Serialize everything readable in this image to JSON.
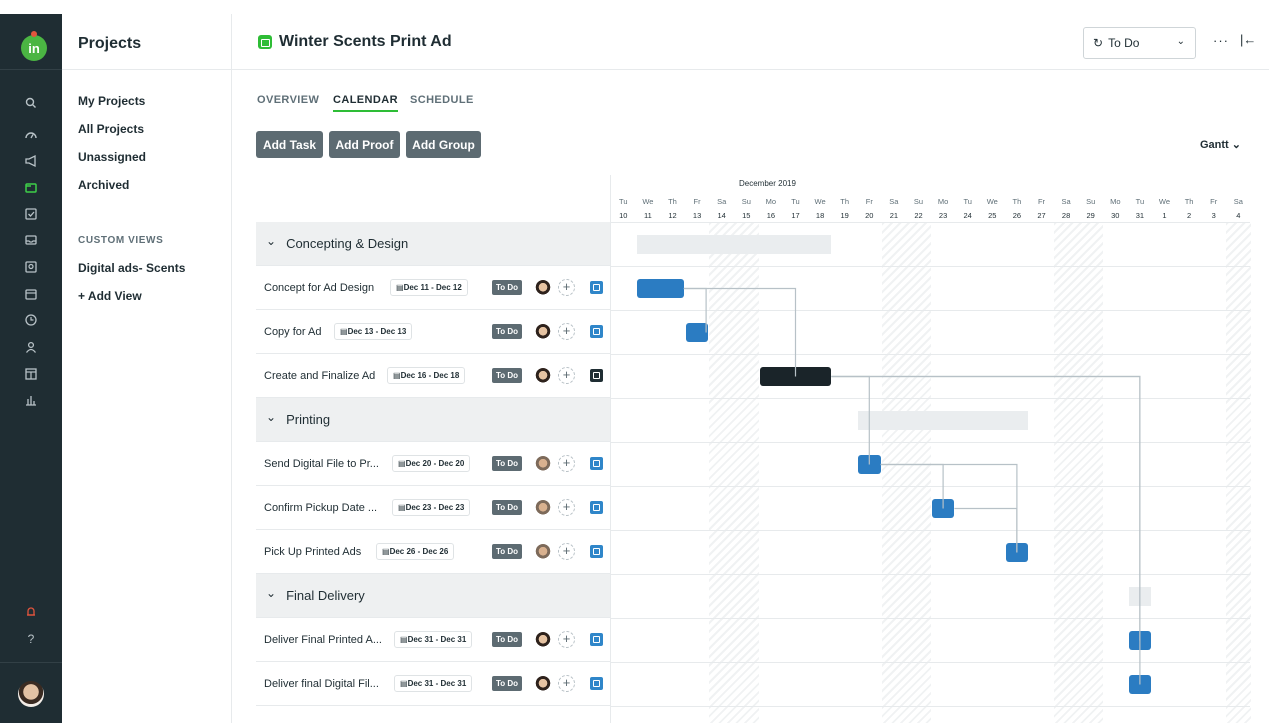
{
  "rail": {
    "logo": "in",
    "icons": [
      "search-icon",
      "dashboard-icon",
      "megaphone-icon",
      "projects-icon",
      "tasks-icon",
      "inbox-icon",
      "review-icon",
      "calendar-icon",
      "time-icon",
      "people-icon",
      "board-icon",
      "reports-icon",
      "notifications-icon",
      "help-icon"
    ]
  },
  "side": {
    "title": "Projects",
    "items": [
      "My Projects",
      "All Projects",
      "Unassigned",
      "Archived"
    ],
    "custom_views_label": "CUSTOM VIEWS",
    "custom_views": [
      "Digital ads- Scents"
    ],
    "add_view": "+ Add View"
  },
  "header": {
    "title": "Winter Scents Print Ad",
    "status": "To Do",
    "more": "···",
    "collapse": "|←"
  },
  "tabs": [
    "OVERVIEW",
    "CALENDAR",
    "SCHEDULE"
  ],
  "active_tab": "CALENDAR",
  "buttons": [
    "Add Task",
    "Add Proof",
    "Add Group"
  ],
  "view_selector": "Gantt ⌄",
  "calendar": {
    "month": "December 2019",
    "day_names": [
      "Tu",
      "We",
      "Th",
      "Fr",
      "Sa",
      "Su",
      "Mo",
      "Tu",
      "We",
      "Th",
      "Fr",
      "Sa",
      "Su",
      "Mo",
      "Tu",
      "We",
      "Th",
      "Fr",
      "Sa",
      "Su",
      "Mo",
      "Tu",
      "We",
      "Th",
      "Fr",
      "Sa"
    ],
    "day_numbers": [
      "10",
      "11",
      "12",
      "13",
      "14",
      "15",
      "16",
      "17",
      "18",
      "19",
      "20",
      "21",
      "22",
      "23",
      "24",
      "25",
      "26",
      "27",
      "28",
      "29",
      "30",
      "31",
      "1",
      "2",
      "3",
      "4"
    ]
  },
  "rows": [
    {
      "type": "group",
      "name": "Concepting & Design"
    },
    {
      "type": "task",
      "name": "Concept for Ad Design",
      "dates": "Dec 11 - Dec 12",
      "status": "To Do",
      "icon": "proof-icon",
      "face": "a"
    },
    {
      "type": "task",
      "name": "Copy for Ad",
      "dates": "Dec 13 - Dec 13",
      "status": "To Do",
      "icon": "proof-icon",
      "face": "a"
    },
    {
      "type": "task",
      "name": "Create and Finalize Ad",
      "dates": "Dec 16 - Dec 18",
      "status": "To Do",
      "icon": "review-icon",
      "face": "a"
    },
    {
      "type": "group",
      "name": "Printing"
    },
    {
      "type": "task",
      "name": "Send Digital File to Pr...",
      "dates": "Dec 20 - Dec 20",
      "status": "To Do",
      "icon": "proof-icon",
      "face": "b"
    },
    {
      "type": "task",
      "name": "Confirm Pickup Date ...",
      "dates": "Dec 23 - Dec 23",
      "status": "To Do",
      "icon": "proof-icon",
      "face": "b"
    },
    {
      "type": "task",
      "name": "Pick Up Printed Ads",
      "dates": "Dec 26 - Dec 26",
      "status": "To Do",
      "icon": "proof-icon",
      "face": "b"
    },
    {
      "type": "group",
      "name": "Final Delivery"
    },
    {
      "type": "task",
      "name": "Deliver Final Printed A...",
      "dates": "Dec 31 - Dec 31",
      "status": "To Do",
      "icon": "proof-icon",
      "face": "a"
    },
    {
      "type": "task",
      "name": "Deliver final Digital Fil...",
      "dates": "Dec 31 - Dec 31",
      "status": "To Do",
      "icon": "proof-icon",
      "face": "a"
    }
  ],
  "colors": {
    "accent": "#2ebd36",
    "bar": "#2b7cc2",
    "bar_dark": "#1a2429",
    "rail": "#1f2d33"
  }
}
